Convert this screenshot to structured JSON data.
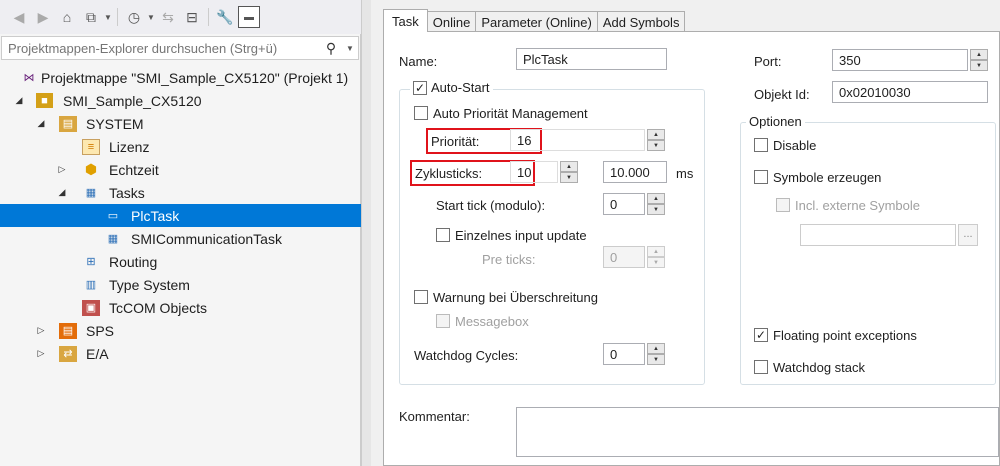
{
  "explorer": {
    "search_placeholder": "Projektmappen-Explorer durchsuchen (Strg+ü)",
    "tree": [
      {
        "label": "Projektmappe \"SMI_Sample_CX5120\" (Projekt 1)",
        "icon": "solution-icon"
      },
      {
        "label": "SMI_Sample_CX5120",
        "icon": "project-icon"
      },
      {
        "label": "SYSTEM",
        "icon": "system-icon"
      },
      {
        "label": "Lizenz",
        "icon": "license-icon"
      },
      {
        "label": "Echtzeit",
        "icon": "realtime-icon"
      },
      {
        "label": "Tasks",
        "icon": "tasks-icon"
      },
      {
        "label": "PlcTask",
        "icon": "task-icon"
      },
      {
        "label": "SMICommunicationTask",
        "icon": "task-icon"
      },
      {
        "label": "Routing",
        "icon": "routing-icon"
      },
      {
        "label": "Type System",
        "icon": "type-system-icon"
      },
      {
        "label": "TcCOM Objects",
        "icon": "tccom-icon"
      },
      {
        "label": "SPS",
        "icon": "plc-icon"
      },
      {
        "label": "E/A",
        "icon": "io-icon"
      }
    ],
    "selected": "PlcTask"
  },
  "tabs": [
    "Task",
    "Online",
    "Parameter (Online)",
    "Add Symbols"
  ],
  "active_tab": "Task",
  "form": {
    "name_label": "Name:",
    "name_value": "PlcTask",
    "auto_start_label": "Auto-Start",
    "auto_start_checked": true,
    "auto_prio_label": "Auto Priorität Management",
    "auto_prio_checked": false,
    "priority_label": "Priorität:",
    "priority_value": "16",
    "cycle_ticks_label": "Zyklusticks:",
    "cycle_ticks_value": "10",
    "cycle_time_value": "10.000",
    "cycle_time_unit": "ms",
    "start_tick_label": "Start tick (modulo):",
    "start_tick_value": "0",
    "single_input_label": "Einzelnes input update",
    "single_input_checked": false,
    "pre_ticks_label": "Pre ticks:",
    "pre_ticks_value": "0",
    "warn_overrun_label": "Warnung bei Überschreitung",
    "warn_overrun_checked": false,
    "messagebox_label": "Messagebox",
    "watchdog_cycles_label": "Watchdog Cycles:",
    "watchdog_cycles_value": "0",
    "port_label": "Port:",
    "port_value": "350",
    "object_id_label": "Objekt Id:",
    "object_id_value": "0x02010030",
    "options_title": "Optionen",
    "disable_label": "Disable",
    "create_symbols_label": "Symbole erzeugen",
    "incl_ext_symbols_label": "Incl. externe Symbole",
    "browse_label": "...",
    "floating_point_label": "Floating point exceptions",
    "floating_point_checked": true,
    "watchdog_stack_label": "Watchdog stack",
    "comment_label": "Kommentar:",
    "comment_value": ""
  },
  "colors": {
    "selection": "#0078d7",
    "highlight_box": "#e0131b"
  }
}
